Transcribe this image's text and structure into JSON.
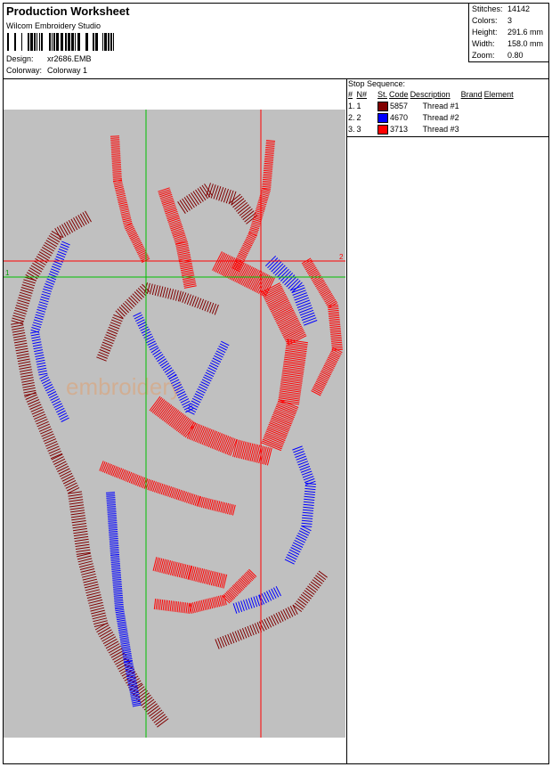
{
  "header": {
    "title": "Production Worksheet",
    "software": "Wilcom  Embroidery Studio",
    "design_label": "Design:",
    "design_value": "xr2686.EMB",
    "colorway_label": "Colorway:",
    "colorway_value": "Colorway 1"
  },
  "stats": [
    {
      "label": "Stitches:",
      "value": "14142"
    },
    {
      "label": "Colors:",
      "value": "3"
    },
    {
      "label": "Height:",
      "value": "291.6 mm"
    },
    {
      "label": "Width:",
      "value": "158.0 mm"
    },
    {
      "label": "Zoom:",
      "value": "0.80"
    }
  ],
  "stop_sequence": {
    "title": "Stop Sequence:",
    "columns": [
      "#",
      "N#",
      "St.",
      "Code",
      "Description",
      "Brand",
      "Element"
    ],
    "rows": [
      {
        "num": "1.",
        "n": "1",
        "color": "#800000",
        "code": "5857",
        "description": "Thread #1"
      },
      {
        "num": "2.",
        "n": "2",
        "color": "#0000ff",
        "code": "4670",
        "description": "Thread #2"
      },
      {
        "num": "3.",
        "n": "3",
        "color": "#ff0000",
        "code": "3713",
        "description": "Thread #3"
      }
    ]
  },
  "preview": {
    "background": "#c0c0c0",
    "guide_green": "#00c000",
    "guide_red": "#ff0000",
    "marker_1": "1",
    "marker_2": "2",
    "watermark": "embroidery"
  }
}
